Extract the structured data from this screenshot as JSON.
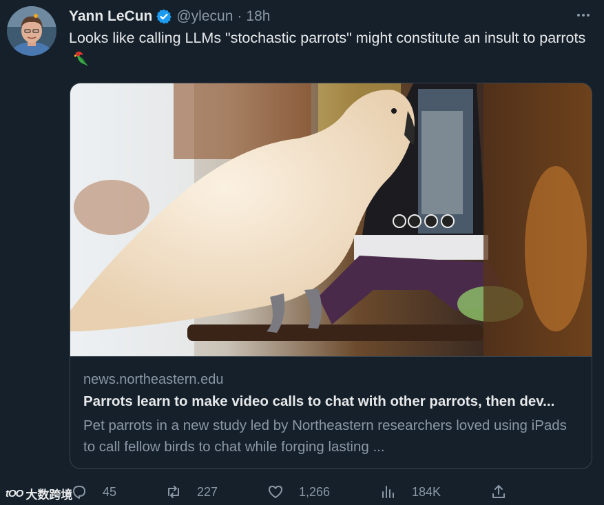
{
  "author": {
    "name": "Yann LeCun",
    "handle": "@ylecun",
    "separator": "·",
    "time": "18h",
    "verified_color": "#1d9bf0"
  },
  "tweet": {
    "text": "Looks like calling LLMs \"stochastic parrots\" might constitute an insult to parrots",
    "emoji": "parrot-emoji"
  },
  "card": {
    "domain": "news.northeastern.edu",
    "title": "Parrots learn to make video calls to chat with other parrots, then dev...",
    "description": "Pet parrots in a new study led by Northeastern researchers loved using iPads to call fellow birds to chat while forging lasting ..."
  },
  "actions": {
    "replies": "45",
    "retweets": "227",
    "likes": "1,266",
    "views": "184K"
  },
  "watermark": {
    "logo": "tOO",
    "text": "大数跨境"
  },
  "icons": [
    "more-icon",
    "verified-icon",
    "reply-icon",
    "retweet-icon",
    "like-icon",
    "views-icon",
    "share-icon"
  ],
  "colors": {
    "background": "#15202b",
    "text": "#e7e9ea",
    "muted": "#8b98a5",
    "border": "#38444d",
    "accent": "#1d9bf0"
  }
}
